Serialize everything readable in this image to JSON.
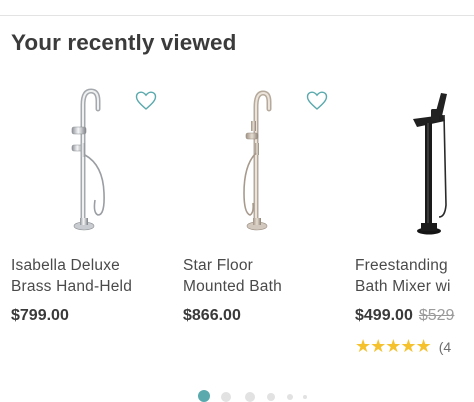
{
  "section": {
    "title": "Your recently viewed"
  },
  "colors": {
    "accent": "#5aa9ad",
    "star": "#f5c22e",
    "price": "#3a3a3a",
    "old_price": "#9b9b9b",
    "dot_inactive": "#e2e2e2"
  },
  "products": [
    {
      "name_line1": "Isabella Deluxe",
      "name_line2": "Brass Hand-Held",
      "price": "$799.00",
      "finish": "chrome",
      "wishlist_icon": "heart-outline-icon"
    },
    {
      "name_line1": "Star Floor",
      "name_line2": "Mounted Bath",
      "price": "$866.00",
      "finish": "brushed-nickel",
      "wishlist_icon": "heart-outline-icon"
    },
    {
      "name_line1": "Freestanding",
      "name_line2": "Bath Mixer wi",
      "price": "$499.00",
      "old_price": "$529",
      "stars": "★★★★★",
      "rating": 5,
      "review_count": "(4",
      "finish": "matte-black"
    }
  ],
  "pagination": {
    "active_index": 0,
    "dot_count": 6
  }
}
